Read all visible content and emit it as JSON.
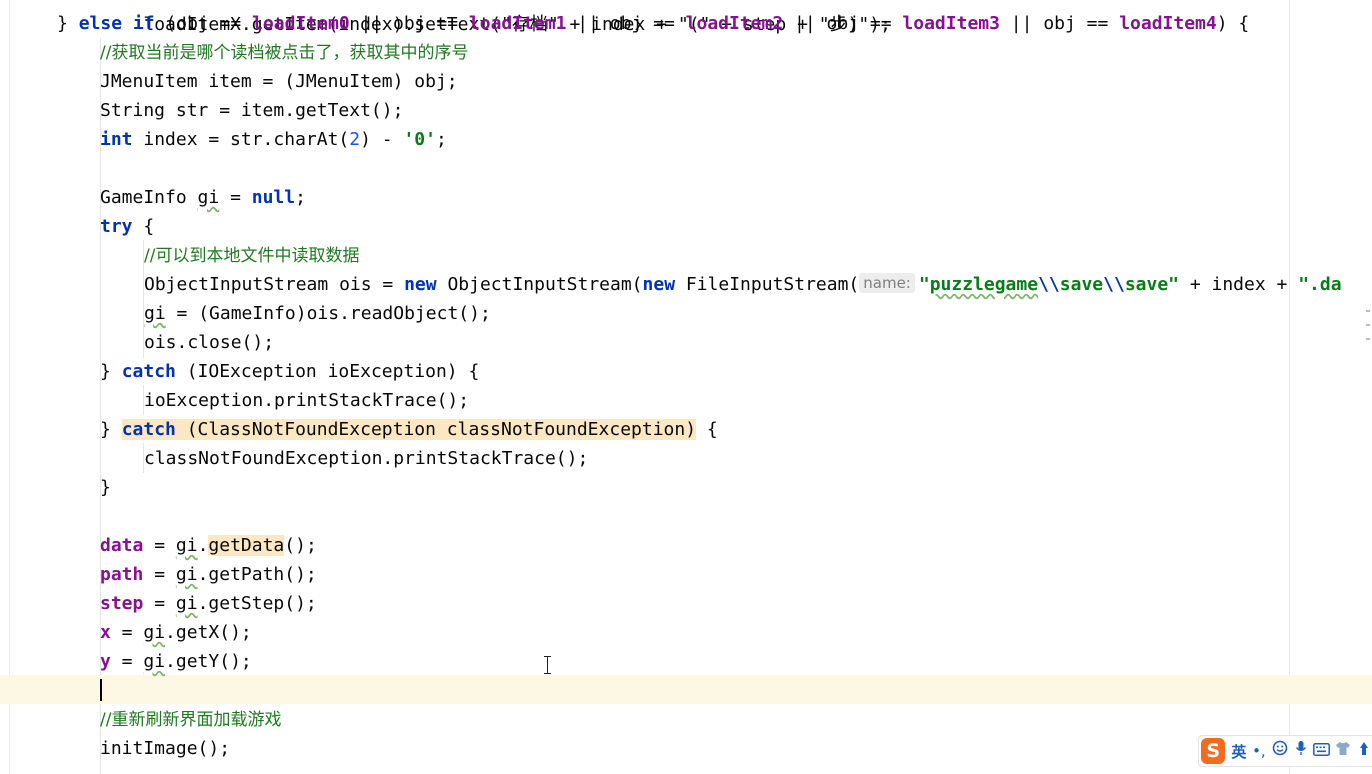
{
  "editor": {
    "partial_top_line": "loadItemX.getItem(index).setText(\"存档\" + index + \"(\" + step + \"步)\");",
    "lines": {
      "l01": {
        "prefix": "} ",
        "else": "else",
        "if": "if",
        "open": " (obj == ",
        "f0": "loadItem0",
        "o1": " || obj == ",
        "f1": "loadItem1",
        "o2": " || obj == ",
        "f2": "loadItem2",
        "o3": " || obj == ",
        "f3": "loadItem3",
        "o4": " || obj == ",
        "f4": "loadItem4",
        "close": ") {"
      },
      "l02": {
        "comment": "//获取当前是哪个读档被点击了，获取其中的序号"
      },
      "l03": {
        "text": "JMenuItem item = (JMenuItem) obj;"
      },
      "l04": {
        "text": "String str = item.getText();"
      },
      "l05": {
        "kw": "int",
        "a": " index = str.charAt(",
        "num": "2",
        "b": ") - ",
        "str": "'0'",
        "c": ";"
      },
      "l07": {
        "a": "GameInfo ",
        "gi": "gi",
        "b": " = ",
        "kw": "null",
        "c": ";"
      },
      "l08": {
        "kw": "try",
        "a": " {"
      },
      "l09": {
        "comment": "//可以到本地文件中读取数据"
      },
      "l10": {
        "a": "ObjectInputStream ois = ",
        "kw1": "new",
        "b": " ObjectInputStream(",
        "kw2": "new",
        "c": " FileInputStream(",
        "hint": "name:",
        "s1": "\"",
        "s2": "puzzlegame",
        "e1": "\\\\",
        "s3": "save",
        "e2": "\\\\",
        "s4": "save\"",
        "d": " + index + ",
        "s5": "\".da"
      },
      "l11": {
        "gi": "gi",
        "a": " = (GameInfo)ois.readObject();"
      },
      "l12": {
        "text": "ois.close();"
      },
      "l13": {
        "a": "} ",
        "kw": "catch",
        "b": " (IOException ioException) {"
      },
      "l14": {
        "text": "ioException.printStackTrace();"
      },
      "l15": {
        "a": "} ",
        "kw": "catch",
        "b": " (ClassNotFoundException classNotFoundException)",
        "c": " {"
      },
      "l16": {
        "text": "classNotFoundException.printStackTrace();"
      },
      "l17": {
        "text": "}"
      },
      "l19": {
        "f": "data",
        "a": " = ",
        "gi": "gi",
        "b": ".",
        "m": "getData",
        "c": "();"
      },
      "l20": {
        "f": "path",
        "a": " = ",
        "gi": "gi",
        "b": ".getPath();"
      },
      "l21": {
        "f": "step",
        "a": " = ",
        "gi": "gi",
        "b": ".getStep();"
      },
      "l22": {
        "f": "x",
        "a": " = ",
        "gi": "gi",
        "b": ".getX();"
      },
      "l23": {
        "f": "y",
        "a": " = ",
        "gi": "gi",
        "b": ".getY();"
      },
      "l25": {
        "comment": "//重新刷新界面加载游戏"
      },
      "l26": {
        "text": "initImage();"
      }
    }
  },
  "ime": {
    "logo": "S",
    "mode": "英",
    "punct": "•,",
    "icons": [
      "emoji-icon",
      "microphone-icon",
      "keyboard-icon",
      "shirt-icon",
      "toolbox-icon"
    ],
    "brand_color": "#f26b21"
  },
  "colors": {
    "keyword": "#0033b3",
    "field": "#871094",
    "string": "#067d17",
    "number": "#1750eb",
    "comment": "#1f7a1f",
    "current_line": "#fdf8e3",
    "usage_highlight": "#fbe8c2"
  }
}
